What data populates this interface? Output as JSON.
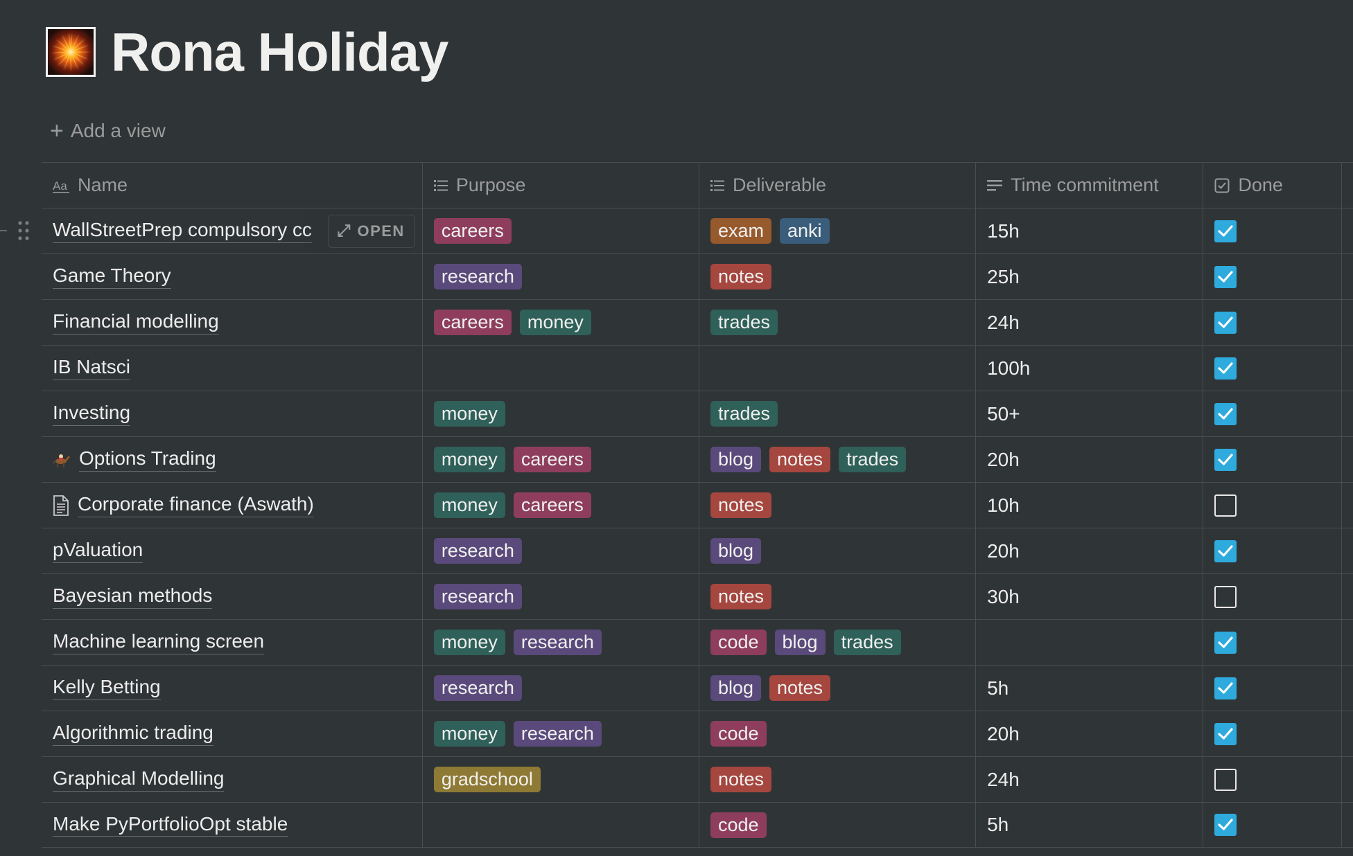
{
  "page": {
    "title": "Rona Holiday",
    "add_view": "Add a view",
    "icon": "fireworks-image"
  },
  "columns": [
    {
      "label": "Name",
      "icon": "text-icon"
    },
    {
      "label": "Purpose",
      "icon": "list-icon"
    },
    {
      "label": "Deliverable",
      "icon": "list-icon"
    },
    {
      "label": "Time commitment",
      "icon": "text-lines-icon"
    },
    {
      "label": "Done",
      "icon": "checkbox-icon"
    }
  ],
  "open_button": "OPEN",
  "rows": [
    {
      "name": "WallStreetPrep compulsory cc",
      "icon": "",
      "purpose": [
        "careers"
      ],
      "deliverable": [
        "exam",
        "anki"
      ],
      "time": "15h",
      "done": true
    },
    {
      "name": "Game Theory",
      "icon": "",
      "purpose": [
        "research"
      ],
      "deliverable": [
        "notes"
      ],
      "time": "25h",
      "done": true
    },
    {
      "name": "Financial modelling",
      "icon": "",
      "purpose": [
        "careers",
        "money"
      ],
      "deliverable": [
        "trades"
      ],
      "time": "24h",
      "done": true
    },
    {
      "name": "IB Natsci",
      "icon": "",
      "purpose": [],
      "deliverable": [],
      "time": "100h",
      "done": true
    },
    {
      "name": "Investing",
      "icon": "",
      "purpose": [
        "money"
      ],
      "deliverable": [
        "trades"
      ],
      "time": "50+",
      "done": true
    },
    {
      "name": "Options Trading",
      "icon": "horse-racing-icon",
      "purpose": [
        "money",
        "careers"
      ],
      "deliverable": [
        "blog",
        "notes",
        "trades"
      ],
      "time": "20h",
      "done": true
    },
    {
      "name": "Corporate finance (Aswath)",
      "icon": "document-icon",
      "purpose": [
        "money",
        "careers"
      ],
      "deliverable": [
        "notes"
      ],
      "time": "10h",
      "done": false
    },
    {
      "name": "pValuation",
      "icon": "",
      "purpose": [
        "research"
      ],
      "deliverable": [
        "blog"
      ],
      "time": "20h",
      "done": true
    },
    {
      "name": "Bayesian methods",
      "icon": "",
      "purpose": [
        "research"
      ],
      "deliverable": [
        "notes"
      ],
      "time": "30h",
      "done": false
    },
    {
      "name": "Machine learning screen",
      "icon": "",
      "purpose": [
        "money",
        "research"
      ],
      "deliverable": [
        "code",
        "blog",
        "trades"
      ],
      "time": "",
      "done": true
    },
    {
      "name": "Kelly Betting",
      "icon": "",
      "purpose": [
        "research"
      ],
      "deliverable": [
        "blog",
        "notes"
      ],
      "time": "5h",
      "done": true
    },
    {
      "name": "Algorithmic trading",
      "icon": "",
      "purpose": [
        "money",
        "research"
      ],
      "deliverable": [
        "code"
      ],
      "time": "20h",
      "done": true
    },
    {
      "name": "Graphical Modelling",
      "icon": "",
      "purpose": [
        "gradschool"
      ],
      "deliverable": [
        "notes"
      ],
      "time": "24h",
      "done": false
    },
    {
      "name": "Make PyPortfolioOpt stable",
      "icon": "",
      "purpose": [],
      "deliverable": [
        "code"
      ],
      "time": "5h",
      "done": true
    }
  ],
  "colors": {
    "background": "#2f3437",
    "checkbox_checked": "#2eaadc",
    "careers": "#8e3e5c",
    "money": "#2f6059",
    "research": "#5a4a7b",
    "gradschool": "#8e7a34",
    "exam": "#975a2c",
    "anki": "#395d7b",
    "notes": "#a5463f",
    "trades": "#2f6059",
    "blog": "#5a4a7b",
    "code": "#8e3e5c"
  }
}
